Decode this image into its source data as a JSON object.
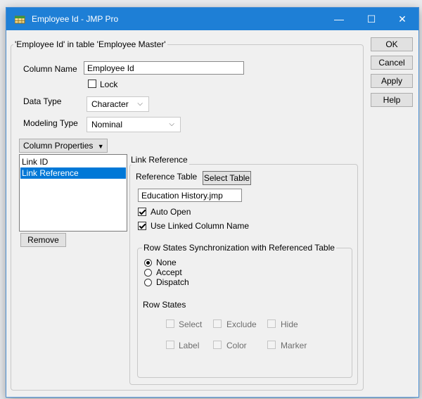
{
  "window": {
    "title": "Employee Id - JMP Pro",
    "minimize": "—",
    "maximize": "☐",
    "close": "✕"
  },
  "main_group": {
    "legend": "'Employee Id' in table 'Employee Master'"
  },
  "column_name": {
    "label": "Column Name",
    "value": "Employee Id"
  },
  "lock": {
    "label": "Lock",
    "checked": false
  },
  "data_type": {
    "label": "Data Type",
    "value": "Character"
  },
  "modeling_type": {
    "label": "Modeling Type",
    "value": "Nominal"
  },
  "column_properties": {
    "label": "Column Properties",
    "arrow": "▼"
  },
  "properties_list": {
    "items": [
      "Link ID",
      "Link Reference"
    ],
    "selected_index": 1
  },
  "remove_button": "Remove",
  "side_buttons": {
    "ok": "OK",
    "cancel": "Cancel",
    "apply": "Apply",
    "help": "Help"
  },
  "link_reference": {
    "legend": "Link Reference",
    "reference_table_label": "Reference Table",
    "select_table_button": "Select Table",
    "table_path": "Education History.jmp",
    "auto_open": {
      "label": "Auto Open",
      "checked": true
    },
    "use_linked_column_name": {
      "label": "Use Linked Column Name",
      "checked": true
    }
  },
  "row_states_sync": {
    "legend": "Row States Synchronization with Referenced Table",
    "options": [
      "None",
      "Accept",
      "Dispatch"
    ],
    "selected": "None",
    "row_states_label": "Row States",
    "row_states": [
      "Select",
      "Exclude",
      "Hide",
      "Label",
      "Color",
      "Marker"
    ]
  },
  "colors": {
    "titlebar": "#1e7fd6",
    "selection": "#0078d7"
  },
  "icons": {
    "app": "jmp-table-icon",
    "dropdown": "chevron-down-icon"
  }
}
